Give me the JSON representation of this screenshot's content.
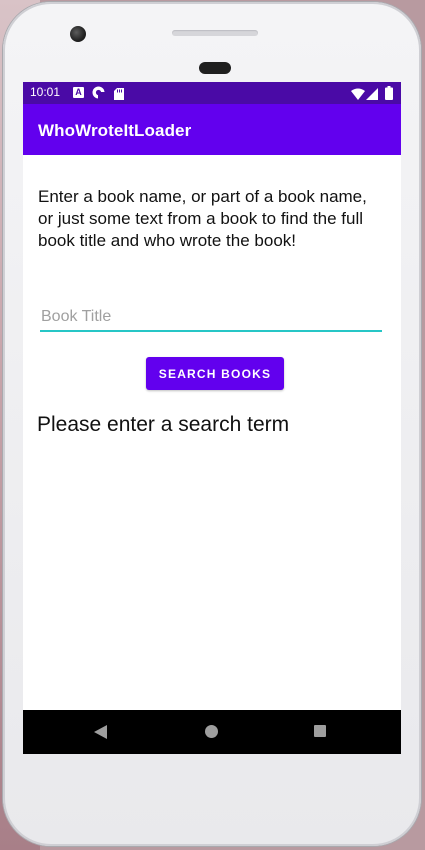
{
  "status_bar": {
    "time": "10:01",
    "left_icons": [
      "a-letter-icon",
      "pocket-casts-icon",
      "sd-card-icon"
    ],
    "right_icons": [
      "wifi-icon",
      "signal-icon",
      "battery-icon"
    ]
  },
  "app_bar": {
    "title": "WhoWroteItLoader"
  },
  "main": {
    "instructions": "Enter a book name, or part of a book name, or just some text from a book to find the full book title and who wrote the book!",
    "book_input": {
      "placeholder": "Book Title",
      "value": ""
    },
    "search_button_label": "SEARCH BOOKS",
    "result_text": "Please enter a search term"
  },
  "nav_bar": {
    "buttons": [
      "back-icon",
      "home-icon",
      "recents-icon"
    ]
  },
  "colors": {
    "primary": "#6200ee",
    "primary_dark": "#4a0aa6",
    "accent": "#26c6c6"
  }
}
